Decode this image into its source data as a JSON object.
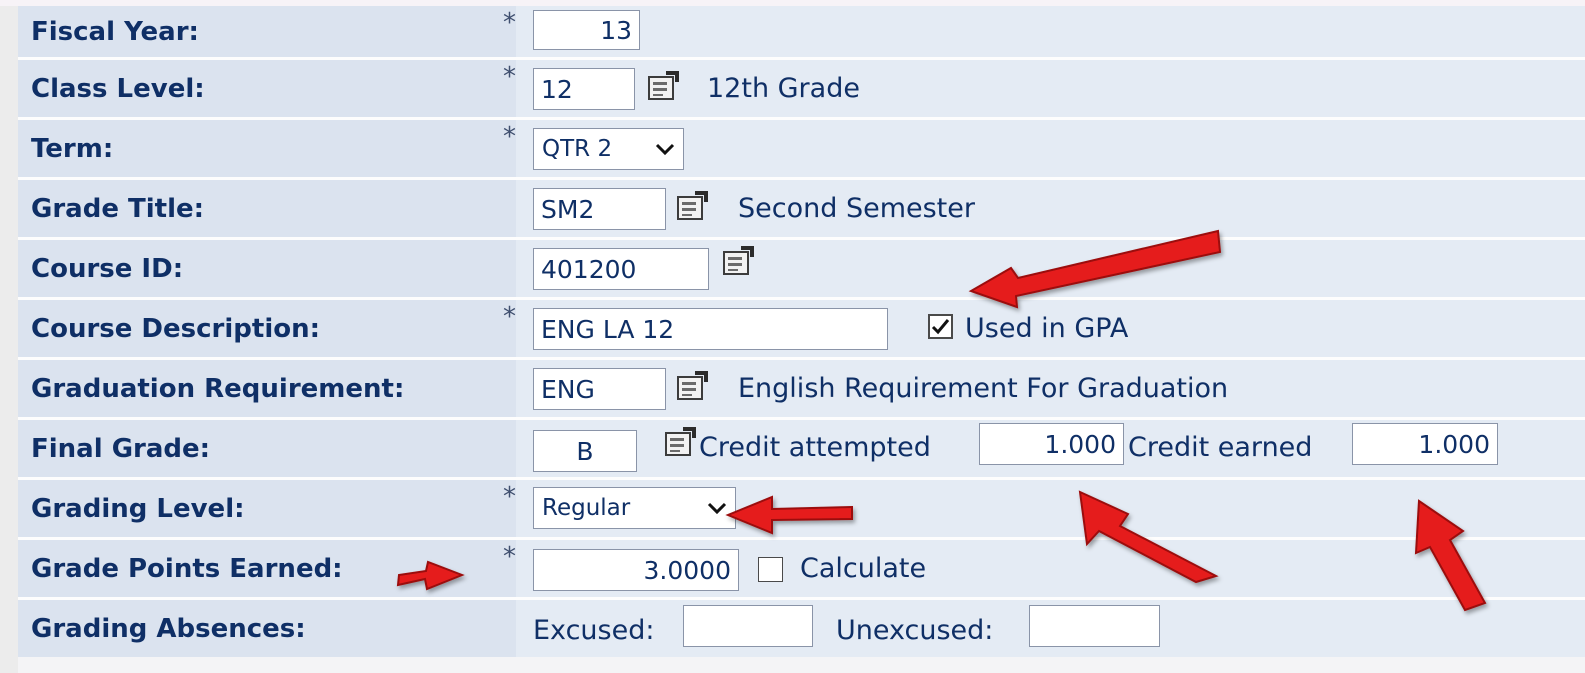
{
  "fiscal_year": {
    "label": "Fiscal Year:",
    "value": "13"
  },
  "class_level": {
    "label": "Class Level:",
    "value": "12",
    "description": "12th Grade"
  },
  "term": {
    "label": "Term:",
    "selected": "QTR 2"
  },
  "grade_title": {
    "label": "Grade Title:",
    "value": "SM2",
    "description": "Second Semester"
  },
  "course_id": {
    "label": "Course ID:",
    "value": "401200"
  },
  "course_description": {
    "label": "Course Description:",
    "value": "ENG LA 12",
    "gpa_label": "Used in GPA",
    "gpa_checked": true
  },
  "graduation_requirement": {
    "label": "Graduation Requirement:",
    "value": "ENG",
    "description": "English Requirement For Graduation"
  },
  "final_grade": {
    "label": "Final Grade:",
    "value": "B",
    "credit_attempted_label": "Credit attempted",
    "credit_attempted_value": "1.000",
    "credit_earned_label": "Credit earned",
    "credit_earned_value": "1.000"
  },
  "grading_level": {
    "label": "Grading Level:",
    "selected": "Regular"
  },
  "grade_points": {
    "label": "Grade Points Earned:",
    "value": "3.0000",
    "calculate_label": "Calculate",
    "calculate_checked": false
  },
  "grading_absences": {
    "label": "Grading Absences:",
    "excused_label": "Excused:",
    "excused_value": "",
    "unexcused_label": "Unexcused:",
    "unexcused_value": ""
  },
  "required_marker": "*",
  "icons": {
    "lookup": "lookup-icon",
    "dropdown": "chevron-down-icon",
    "annotation": "red-arrow-icon"
  },
  "colors": {
    "label_text": "#0f2f66",
    "label_background": "#dbe3ef",
    "field_background": "#e4ebf4",
    "annotation_arrow": "#e51f1f"
  }
}
